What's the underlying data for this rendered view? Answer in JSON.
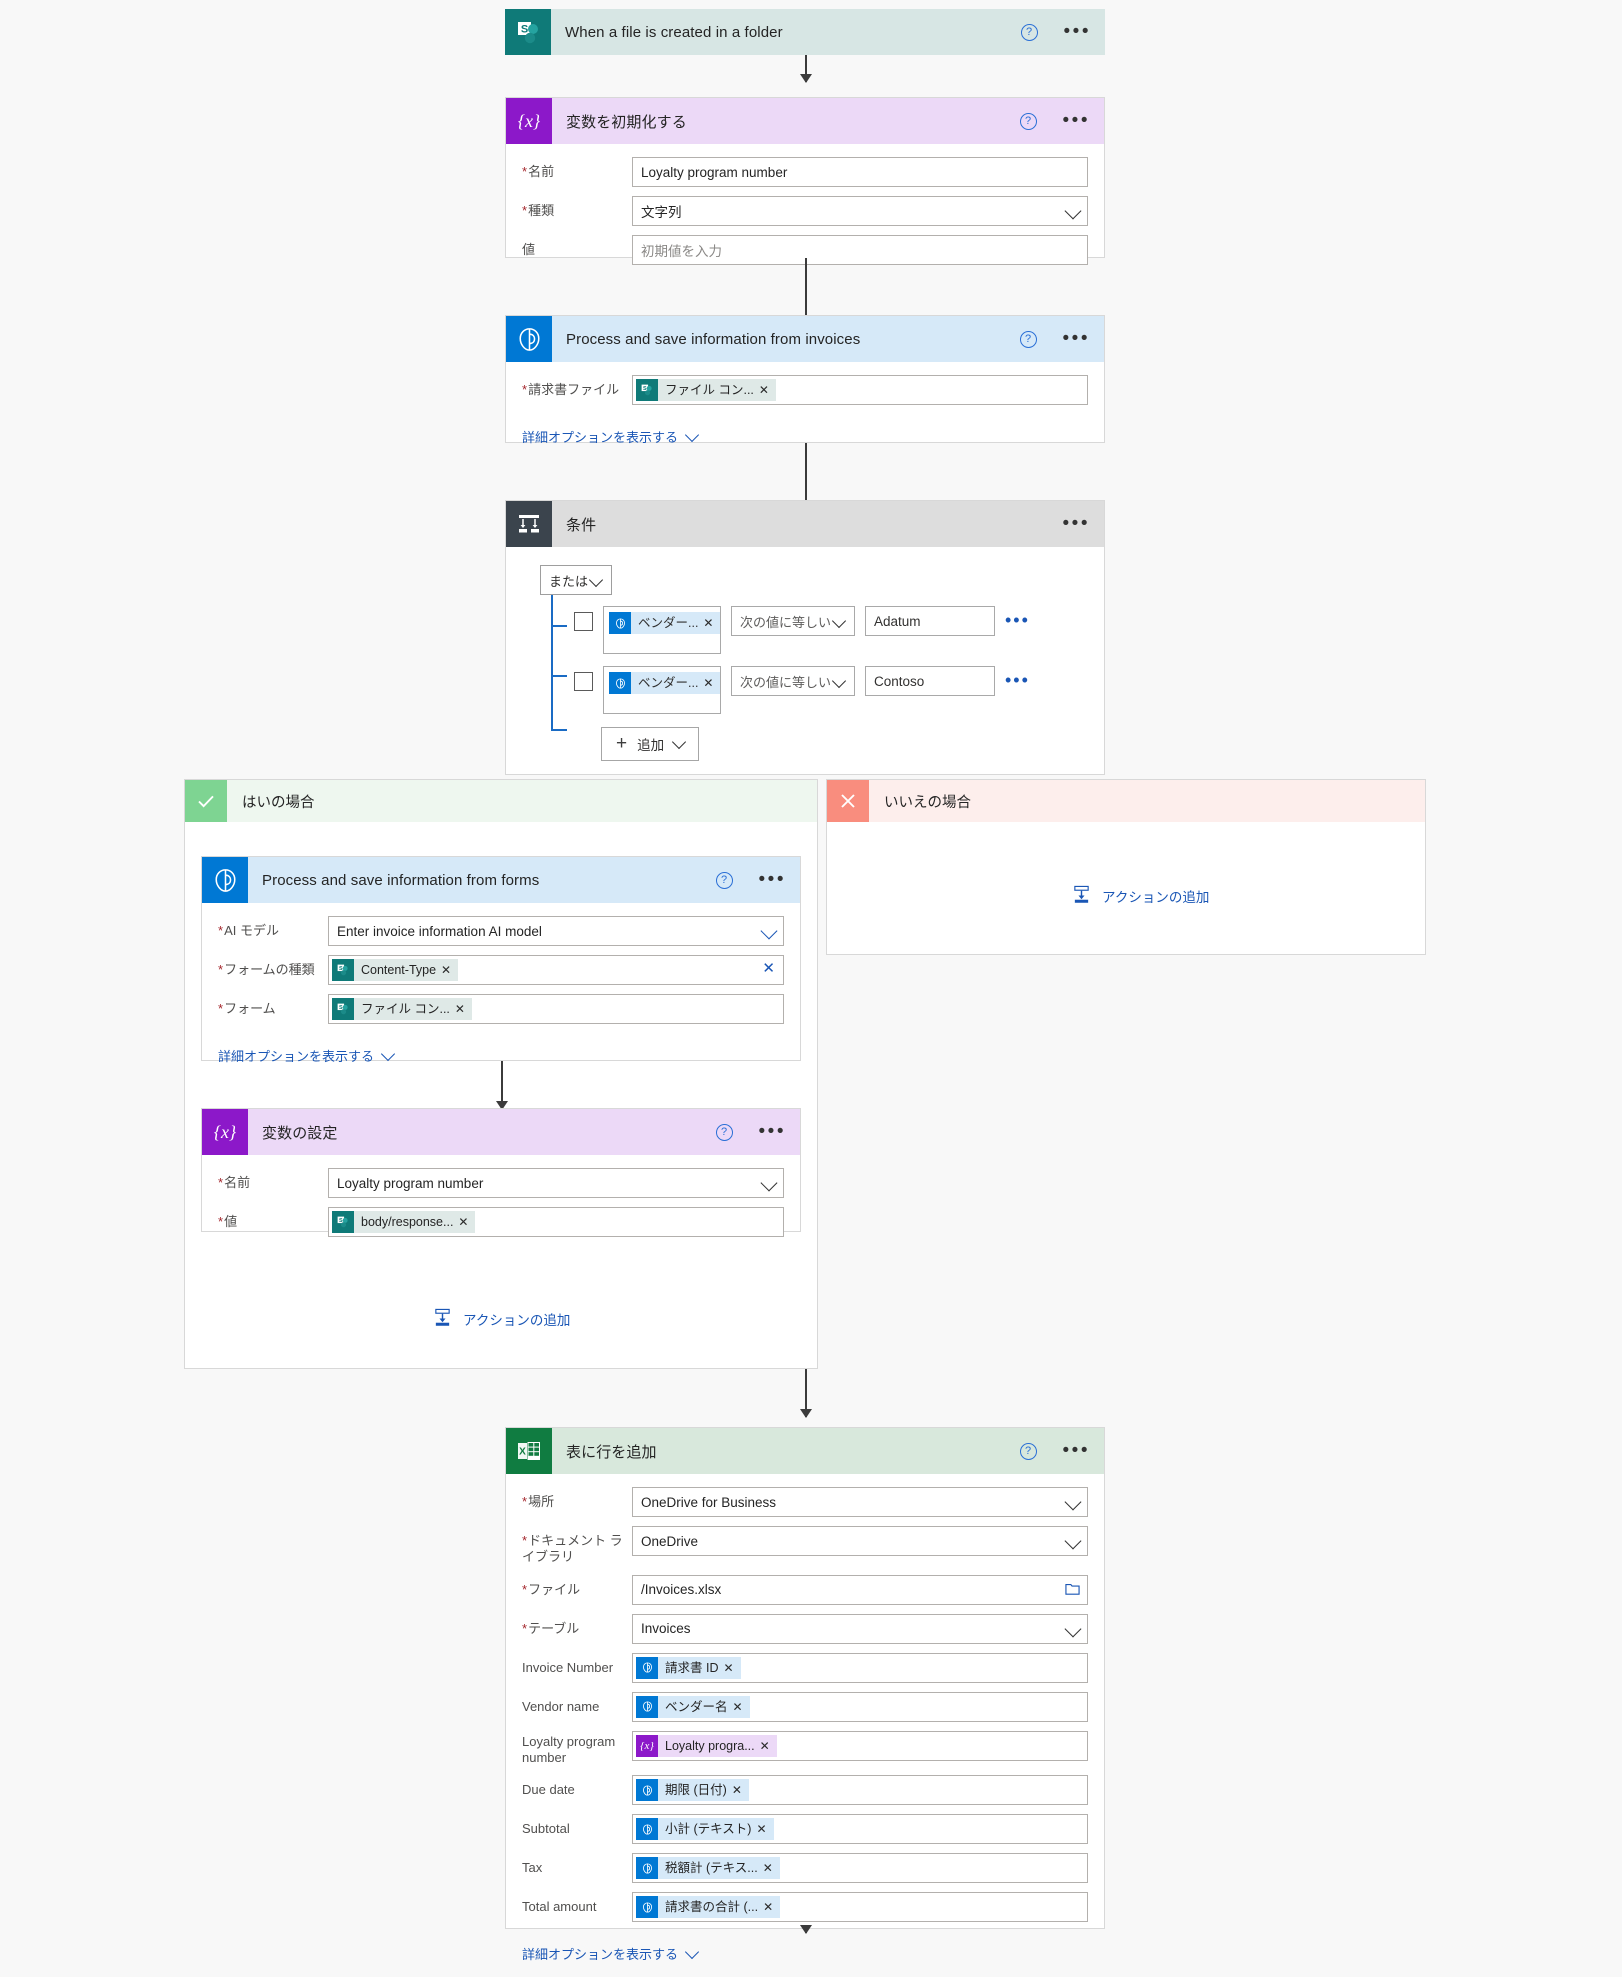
{
  "trigger": {
    "title": "When a file is created in a folder",
    "icon": "sharepoint-icon",
    "help": "?",
    "menu": "•••"
  },
  "init_variable": {
    "title": "変数を初期化する",
    "icon": "variable-icon",
    "fields": [
      {
        "label": "名前",
        "required": true,
        "value": "Loyalty program number",
        "type": "text"
      },
      {
        "label": "種類",
        "required": true,
        "value": "文字列",
        "type": "select"
      },
      {
        "label": "値",
        "required": false,
        "placeholder": "初期値を入力",
        "type": "text"
      }
    ]
  },
  "process_invoices": {
    "title": "Process and save information from invoices",
    "icon": "ai-builder-icon",
    "field_label": "請求書ファイル",
    "token": "ファイル コン...",
    "advanced": "詳細オプションを表示する"
  },
  "condition": {
    "title": "条件",
    "icon": "condition-icon",
    "operator": "または",
    "rows": [
      {
        "token": "ベンダー...",
        "comparison": "次の値に等しい",
        "value": "Adatum"
      },
      {
        "token": "ベンダー...",
        "comparison": "次の値に等しい",
        "value": "Contoso"
      }
    ],
    "add_label": "追加"
  },
  "yes_branch": {
    "label": "はいの場合",
    "icon": "check-icon",
    "process_forms": {
      "title": "Process and save information from forms",
      "icon": "ai-builder-icon",
      "fields": [
        {
          "label": "AI モデル",
          "required": true,
          "value": "Enter invoice information AI model",
          "type": "select"
        },
        {
          "label": "フォームの種類",
          "required": true,
          "token": "Content-Type",
          "type": "token-clear"
        },
        {
          "label": "フォーム",
          "required": true,
          "token": "ファイル コン...",
          "type": "token"
        }
      ],
      "advanced": "詳細オプションを表示する"
    },
    "set_variable": {
      "title": "変数の設定",
      "icon": "variable-icon",
      "fields": [
        {
          "label": "名前",
          "required": true,
          "value": "Loyalty program number",
          "type": "select"
        },
        {
          "label": "値",
          "required": true,
          "token": "body/response...",
          "type": "token"
        }
      ]
    },
    "add_action": "アクションの追加"
  },
  "no_branch": {
    "label": "いいえの場合",
    "icon": "close-icon",
    "add_action": "アクションの追加"
  },
  "add_row_to_table": {
    "title": "表に行を追加",
    "icon": "excel-icon",
    "fields": [
      {
        "label": "場所",
        "required": true,
        "value": "OneDrive for Business",
        "type": "select"
      },
      {
        "label": "ドキュメント ライブラリ",
        "required": true,
        "value": "OneDrive",
        "type": "select"
      },
      {
        "label": "ファイル",
        "required": true,
        "value": "/Invoices.xlsx",
        "type": "folder"
      },
      {
        "label": "テーブル",
        "required": true,
        "value": "Invoices",
        "type": "select"
      },
      {
        "label": "Invoice Number",
        "required": false,
        "token": "請求書 ID",
        "chip": "ai",
        "type": "token"
      },
      {
        "label": "Vendor name",
        "required": false,
        "token": "ベンダー名",
        "chip": "ai",
        "type": "token"
      },
      {
        "label": "Loyalty program number",
        "required": false,
        "token": "Loyalty progra...",
        "chip": "var",
        "type": "token"
      },
      {
        "label": "Due date",
        "required": false,
        "token": "期限 (日付)",
        "chip": "ai",
        "type": "token"
      },
      {
        "label": "Subtotal",
        "required": false,
        "token": "小計 (テキスト)",
        "chip": "ai",
        "type": "token"
      },
      {
        "label": "Tax",
        "required": false,
        "token": "税額計 (テキス...",
        "chip": "ai",
        "type": "token"
      },
      {
        "label": "Total amount",
        "required": false,
        "token": "請求書の合計 (...",
        "chip": "ai",
        "type": "token"
      }
    ],
    "advanced": "詳細オプションを表示する"
  }
}
